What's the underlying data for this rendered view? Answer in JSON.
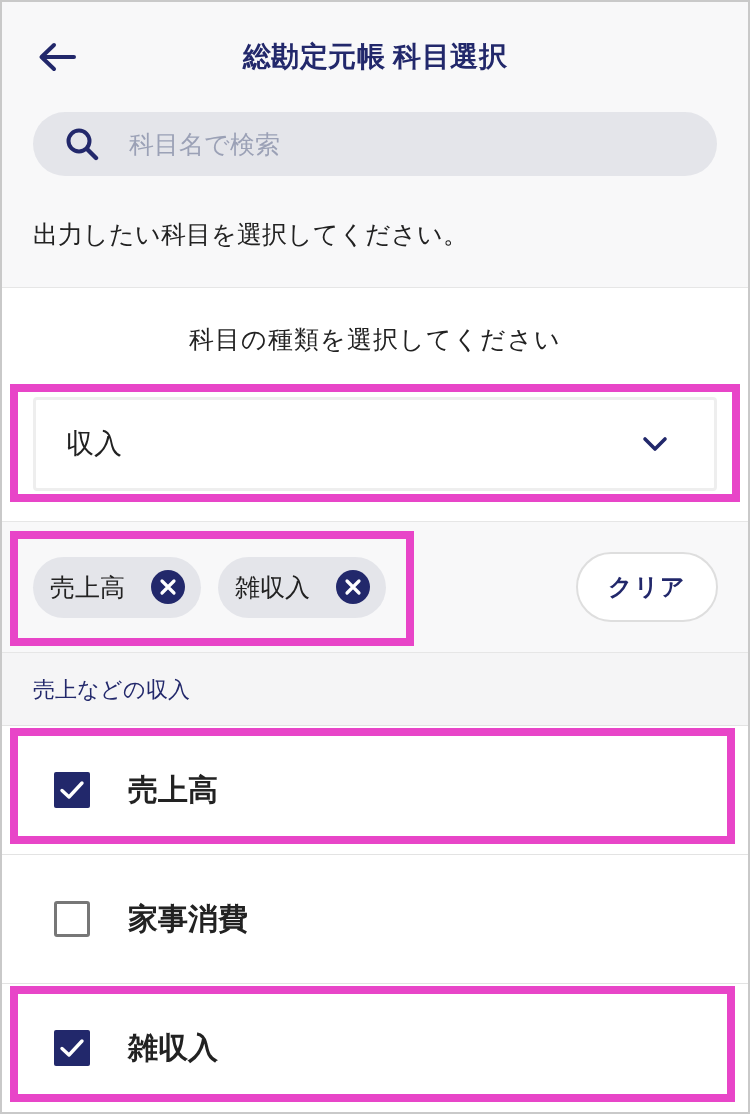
{
  "header": {
    "title": "総勘定元帳 科目選択"
  },
  "search": {
    "placeholder": "科目名で検索"
  },
  "instruction": "出力したい科目を選択してください。",
  "type_select": {
    "label": "科目の種類を選択してください",
    "value": "収入",
    "highlighted": true
  },
  "selected_chips": {
    "highlighted": true,
    "chips": [
      {
        "label": "売上高"
      },
      {
        "label": "雑収入"
      }
    ]
  },
  "clear_button": "クリア",
  "section": {
    "title": "売上などの収入",
    "items": [
      {
        "label": "売上高",
        "checked": true,
        "highlighted": true
      },
      {
        "label": "家事消費",
        "checked": false,
        "highlighted": false
      },
      {
        "label": "雑収入",
        "checked": true,
        "highlighted": true
      }
    ]
  }
}
